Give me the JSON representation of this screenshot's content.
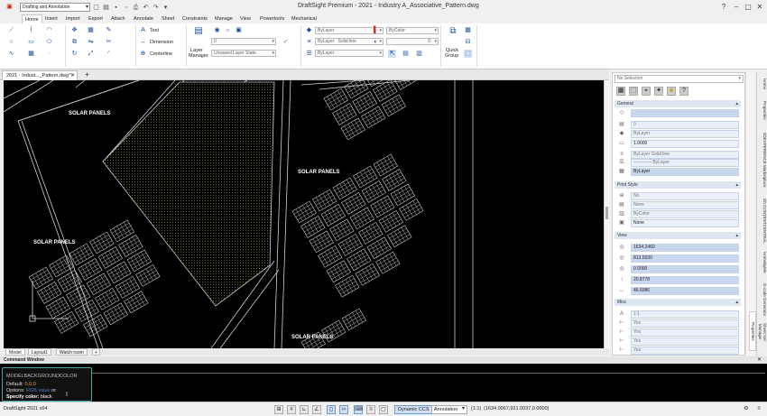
{
  "app": {
    "title": "DraftSight Premium - 2021 - Industry A_Associative_Pattern.dwg",
    "workspace": "Drafting and Annotation"
  },
  "menu": [
    "Home",
    "Insert",
    "Import",
    "Export",
    "Attach",
    "Annotate",
    "Sheet",
    "Constraints",
    "Manage",
    "View",
    "Powertools",
    "Mechanical"
  ],
  "ribbon": {
    "groups": {
      "quick_group_line1": "Quick",
      "quick_group_line2": "Group"
    },
    "annotations": {
      "text": "Text",
      "dimension": "Dimension",
      "centerline": "Centerline"
    },
    "layers": {
      "manager_line1": "Layer",
      "manager_line2": "Manager",
      "state_placeholder": "Unsaved Layer State",
      "layer_row": "0"
    },
    "properties": {
      "color": "ByLayer",
      "linetype": "ByLayer",
      "linestyle": "Solid line",
      "bycolor": "ByColor",
      "lineweight": "ByLayer",
      "transparency": "0"
    }
  },
  "document": {
    "tab": "2021 - Indust..._Pattern.dwg*"
  },
  "drawing": {
    "labels": [
      "SOLAR PANELS",
      "SOLAR PANELS",
      "SOLAR PANELS",
      "SOLAR PANELS"
    ]
  },
  "layout_tabs": [
    "Model",
    "Layout1",
    "Watch room"
  ],
  "command": {
    "header": "Command Window",
    "command_name": "MODELBACKGROUNDCOLOR",
    "default_label": "Default: ",
    "default_value": "0,0,0",
    "options_label": "Options: ",
    "options_value": "RGB value",
    "options_suffix": " or",
    "prompt": "Specify color:",
    "input": " black"
  },
  "status": {
    "app_version": "DraftSight 2021 x64",
    "dynamic_ccs": "Dynamic CCS",
    "annotation": "Annotation",
    "scale": "(1:1)",
    "coordinates": "(1634.0067,921.0037,0.0000)"
  },
  "properties": {
    "selection": "No Selection",
    "general_title": "General",
    "general": [
      "",
      "0",
      "ByLayer",
      "1.0000",
      "ByLayer     Solid line",
      "———— ByLayer",
      "ByLayer"
    ],
    "print_title": "Print Style",
    "print": [
      "No",
      "None",
      "ByColor",
      "None"
    ],
    "view_title": "View",
    "view": [
      "1634.2460",
      "813.5030",
      "0.0000",
      "20.8778",
      "46.6986"
    ],
    "misc_title": "Misc",
    "misc": [
      "1:1",
      "Yes",
      "Yes",
      "Yes",
      "Yes"
    ]
  },
  "palette_tabs": [
    "Home",
    "Properties",
    "3DEXPERIENCE Marketplace",
    "3D CONTENTCENTRAL",
    "HomeByMe",
    "G-code Generator",
    "Sheet Set Manager",
    "Properties"
  ]
}
